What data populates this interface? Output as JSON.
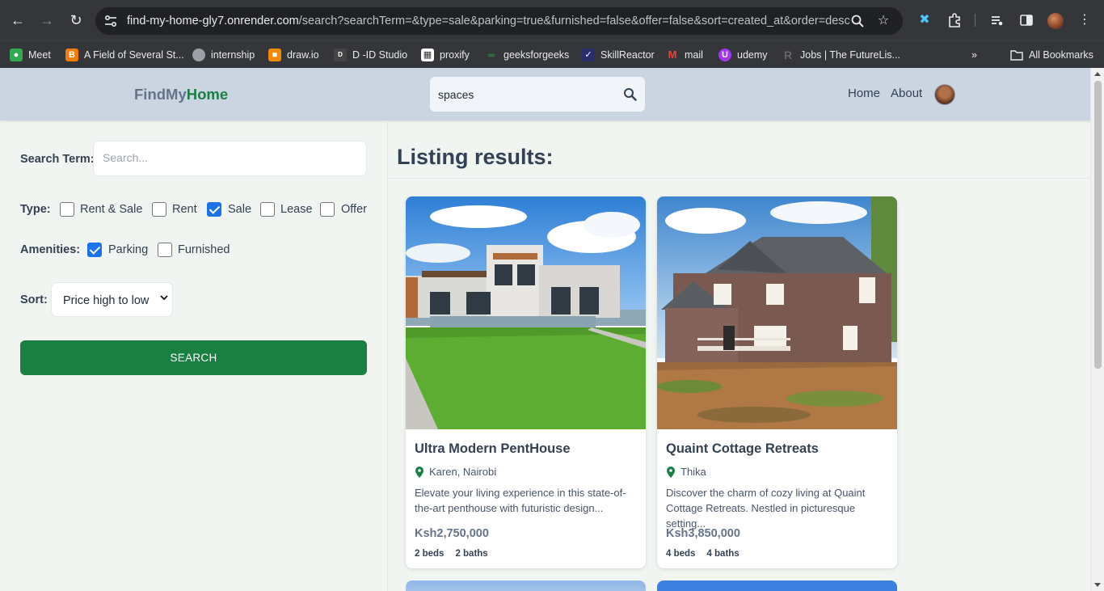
{
  "browser": {
    "url_host": "find-my-home-gly7.onrender.com",
    "url_path": "/search?searchTerm=&type=sale&parking=true&furnished=false&offer=false&sort=created_at&order=desc",
    "bookmarks": [
      {
        "label": "Meet",
        "icon": "meet-icon",
        "color": "#34a853"
      },
      {
        "label": "A Field of Several St...",
        "icon": "blogger-icon",
        "color": "#f57c00"
      },
      {
        "label": "internship",
        "icon": "globe-icon",
        "color": "#9aa0a6"
      },
      {
        "label": "draw.io",
        "icon": "drawio-icon",
        "color": "#f08705"
      },
      {
        "label": "D -ID Studio",
        "icon": "did-icon",
        "color": "#444"
      },
      {
        "label": "proxify",
        "icon": "proxify-icon",
        "color": "#ffffff"
      },
      {
        "label": "geeksforgeeks",
        "icon": "gfg-icon",
        "color": "#2f8d46"
      },
      {
        "label": "SkillReactor",
        "icon": "skillreactor-icon",
        "color": "#2b2d6e"
      },
      {
        "label": "mail",
        "icon": "gmail-icon",
        "color": "#ea4335"
      },
      {
        "label": "udemy",
        "icon": "udemy-icon",
        "color": "#a435f0"
      },
      {
        "label": "Jobs | The FutureLis...",
        "icon": "futurelist-icon",
        "color": "#555"
      }
    ],
    "all_bookmarks_label": "All Bookmarks"
  },
  "header": {
    "logo_part1": "FindMy",
    "logo_part2": "Home",
    "search_value": "spaces",
    "nav": [
      "Home",
      "About"
    ]
  },
  "filters": {
    "search_term_label": "Search Term:",
    "search_placeholder": "Search...",
    "type_label": "Type:",
    "types": [
      {
        "label": "Rent & Sale",
        "checked": false
      },
      {
        "label": "Rent",
        "checked": false
      },
      {
        "label": "Sale",
        "checked": true
      },
      {
        "label": "Lease",
        "checked": false
      },
      {
        "label": "Offer",
        "checked": false
      }
    ],
    "amenities_label": "Amenities:",
    "amenities": [
      {
        "label": "Parking",
        "checked": true
      },
      {
        "label": "Furnished",
        "checked": false
      }
    ],
    "sort_label": "Sort:",
    "sort_value": "Price high to low",
    "search_button": "SEARCH"
  },
  "results": {
    "title": "Listing results:",
    "listings": [
      {
        "title": "Ultra Modern PentHouse",
        "location": "Karen, Nairobi",
        "description": "Elevate your living experience in this state-of-the-art penthouse with futuristic design...",
        "price": "Ksh2,750,000",
        "beds": "2 beds",
        "baths": "2 baths"
      },
      {
        "title": "Quaint Cottage Retreats",
        "location": "Thika",
        "description": "Discover the charm of cozy living at Quaint Cottage Retreats. Nestled in picturesque setting...",
        "price": "Ksh3,850,000",
        "beds": "4 beds",
        "baths": "4 baths"
      }
    ]
  },
  "colors": {
    "brand_green": "#1a7f43",
    "header_bg": "#cbd5e1",
    "page_bg": "#f1f5f1",
    "checkbox_blue": "#1a73e8"
  }
}
